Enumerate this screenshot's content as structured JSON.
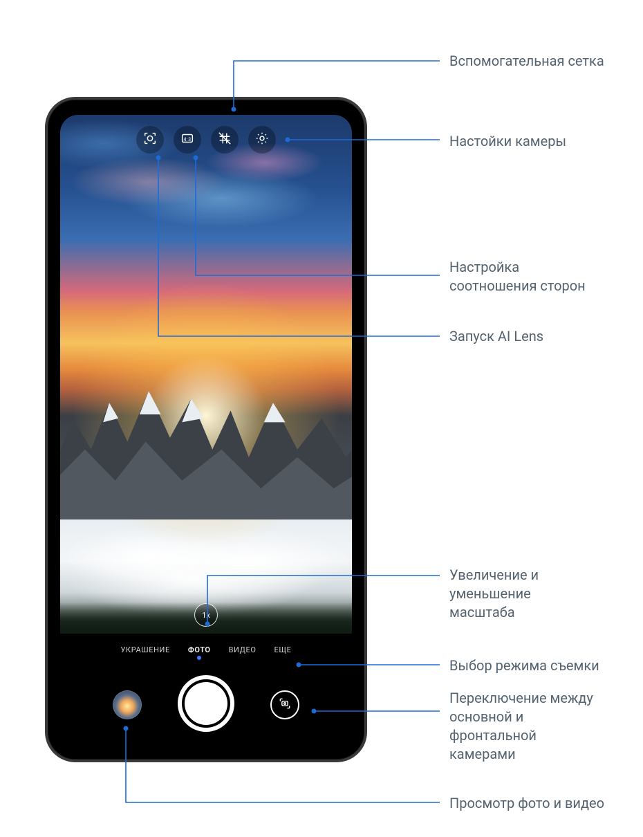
{
  "callouts": {
    "grid": "Вспомогательная сетка",
    "settings": "Настойки камеры",
    "aspect_line1": "Настройка",
    "aspect_line2": "соотношения сторон",
    "ailens": "Запуск AI Lens",
    "zoom_line1": "Увеличение и",
    "zoom_line2": "уменьшение",
    "zoom_line3": "масштаба",
    "modes": "Выбор режима съемки",
    "switch_line1": "Переключение между",
    "switch_line2": "основной и",
    "switch_line3": "фронтальной",
    "switch_line4": "камерами",
    "gallery": "Просмотр фото и видео"
  },
  "zoom_label": "1x",
  "aspect_ratio_text": "4:3",
  "modes": {
    "beauty": "УКРАШЕНИЕ",
    "photo": "ФОТО",
    "video": "ВИДЕО",
    "more": "ЕЩЕ"
  },
  "colors": {
    "leader": "#1f6bd6",
    "text": "#54636f"
  }
}
